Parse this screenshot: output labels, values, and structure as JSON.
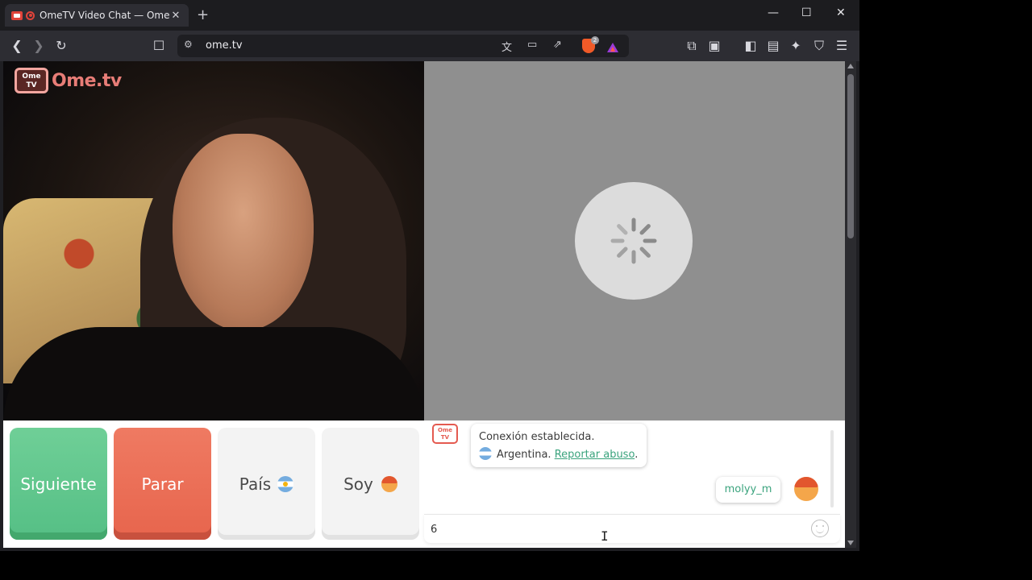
{
  "browser": {
    "tab": {
      "title": "OmeTV Video Chat — Omegl",
      "close": "✕"
    },
    "new_tab": "+",
    "window_controls": {
      "minimize": "—",
      "maximize": "☐",
      "close": "✕"
    },
    "url": "ome.tv",
    "brave_badge": "2"
  },
  "page": {
    "logo": {
      "tv_text": "Ome TV",
      "wordmark": "Ome.tv"
    },
    "controls": {
      "next": "Siguiente",
      "stop": "Parar",
      "country": "País",
      "gender": "Soy"
    },
    "chat": {
      "logo_text": "Ome TV",
      "system_message": "Conexión establecida.",
      "country": "Argentina.",
      "report_link": "Reportar abuso",
      "report_suffix": ".",
      "partner_username": "molyy_m",
      "input_value": "6"
    }
  },
  "colors": {
    "next_button": "#6fcf97",
    "stop_button": "#ef7a62",
    "link": "#3aa37d",
    "partner_video_bg": "#8f8f8f"
  },
  "icons": [
    "back-icon",
    "forward-icon",
    "reload-icon",
    "bookmark-icon",
    "site-settings-icon",
    "translate-icon",
    "cast-icon",
    "share-icon",
    "brave-shields-icon",
    "brave-rewards-icon",
    "extensions-icon",
    "reader-icon",
    "sidebar-icon",
    "wallet-icon",
    "leo-icon",
    "vpn-icon",
    "menu-icon",
    "loading-spinner-icon",
    "emoji-icon"
  ]
}
